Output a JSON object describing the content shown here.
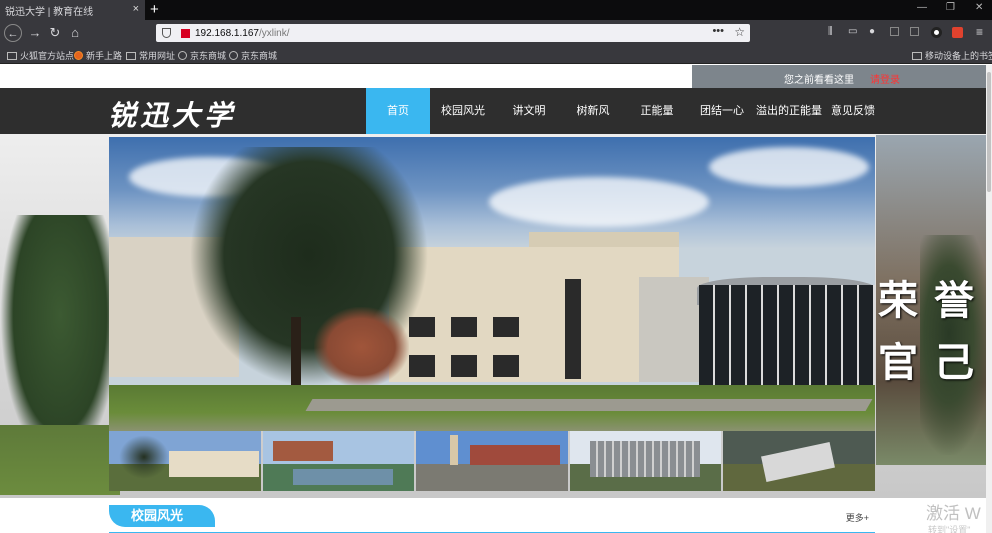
{
  "browser": {
    "tab_title": "锐迅大学 | 教育在线",
    "tab_close": "×",
    "new_tab": "+",
    "minimize": "—",
    "restore": "❐",
    "close": "✕",
    "back": "←",
    "forward": "→",
    "reload": "↻",
    "home": "⌂",
    "url_host": "192.168.1.167",
    "url_path": "/yxlink/",
    "page_actions": "•••",
    "bookmark_star": "☆",
    "library": "⫼",
    "sidebar": "▭",
    "account": "●",
    "menu": "≡",
    "bookmarks": [
      {
        "label": "火狐官方站点",
        "icon": "folder-icon"
      },
      {
        "label": "新手上路",
        "icon": "firefox-icon"
      },
      {
        "label": "常用网址",
        "icon": "folder-icon"
      },
      {
        "label": "京东商城",
        "icon": "globe-icon"
      },
      {
        "label": "京东商城",
        "icon": "globe-icon"
      }
    ],
    "mobile_bookmarks": "移动设备上的书签"
  },
  "site": {
    "topbar": {
      "greeting": "您之前看看这里",
      "login": "请登录"
    },
    "logo": "锐迅大学",
    "nav": [
      {
        "label": "首页",
        "active": true
      },
      {
        "label": "校园风光",
        "active": false
      },
      {
        "label": "讲文明",
        "active": false
      },
      {
        "label": "树新风",
        "active": false
      },
      {
        "label": "正能量",
        "active": false
      },
      {
        "label": "团结一心",
        "active": false
      },
      {
        "label": "溢出的正能量",
        "active": false
      },
      {
        "label": "意见反馈",
        "active": false
      }
    ],
    "motto": "荣誉官己",
    "section": {
      "title": "校园风光",
      "more": "更多+"
    },
    "accent_color": "#3ab7f0"
  },
  "os_overlay": {
    "activate_title": "激活 W",
    "activate_sub": "转到\"设置\""
  }
}
